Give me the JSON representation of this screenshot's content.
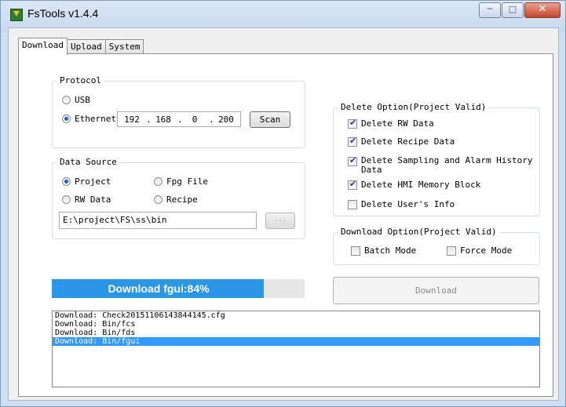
{
  "window": {
    "title": "FsTools v1.4.4"
  },
  "tabs": [
    {
      "label": "Download",
      "active": true
    },
    {
      "label": "Upload",
      "active": false
    },
    {
      "label": "System",
      "active": false
    }
  ],
  "protocol": {
    "legend": "Protocol",
    "usb_label": "USB",
    "ethernet_label": "Ethernet",
    "selected": "Ethernet",
    "ip": [
      "192",
      "168",
      "0",
      "200"
    ],
    "scan_label": "Scan"
  },
  "data_source": {
    "legend": "Data Source",
    "project_label": "Project",
    "fpg_label": "Fpg File",
    "rw_label": "RW Data",
    "recipe_label": "Recipe",
    "selected": "Project",
    "path": "E:\\project\\FS\\ss\\bin",
    "browse_label": "..."
  },
  "delete_option": {
    "legend": "Delete Option(Project Valid)",
    "items": [
      {
        "label": "Delete RW Data",
        "checked": true
      },
      {
        "label": "Delete Recipe Data",
        "checked": true
      },
      {
        "label": "Delete Sampling and Alarm History Data",
        "checked": true
      },
      {
        "label": "Delete HMI Memory Block",
        "checked": true
      },
      {
        "label": "Delete User's Info",
        "checked": false
      }
    ]
  },
  "download_option": {
    "legend": "Download Option(Project Valid)",
    "batch_label": "Batch Mode",
    "batch_checked": false,
    "force_label": "Force Mode",
    "force_checked": false
  },
  "progress": {
    "text": "Download fgui:84%",
    "percent": 84
  },
  "download_button": {
    "label": "Download",
    "enabled": false
  },
  "log": {
    "lines": [
      "Download: Check20151106143844145.cfg",
      "Download: Bin/fcs",
      "Download: Bin/fds",
      "Download: Bin/fgui"
    ],
    "selected_index": 3
  },
  "colors": {
    "progress_fill": "#2a96e8",
    "selection": "#3399ff"
  }
}
